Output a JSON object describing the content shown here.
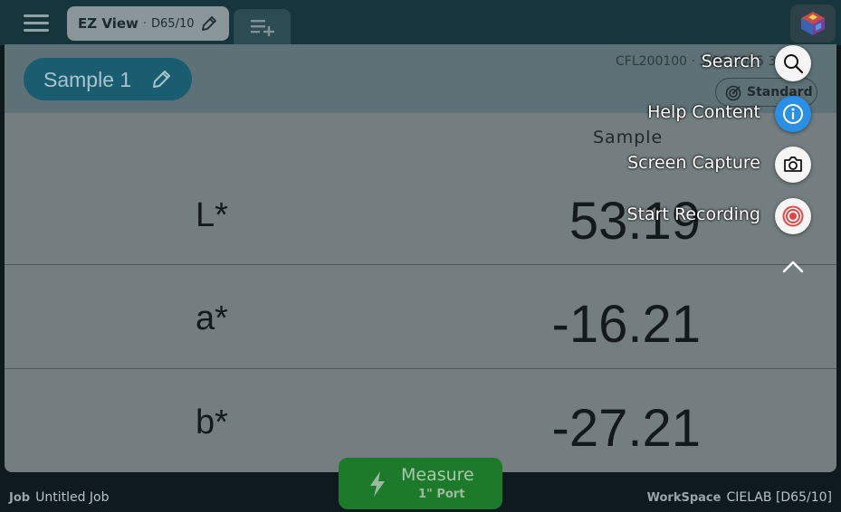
{
  "topbar": {
    "menu_icon": "hamburger-icon",
    "view_tab": {
      "title": "EZ View",
      "separator": "·",
      "illuminant": "D65/10",
      "edit_icon": "pencil-icon"
    },
    "add_tab_icon": "playlist-add-icon",
    "logo_icon": "color-cube-logo"
  },
  "sample": {
    "name": "Sample 1",
    "edit_icon": "pencil-icon"
  },
  "instrument": {
    "text": "CFL200100 · 3/06/2025 3:26"
  },
  "standard": {
    "label": "Standard",
    "icon": "target-icon"
  },
  "table": {
    "column_header": "Sample",
    "rows": [
      {
        "label": "L*",
        "value": "53.19"
      },
      {
        "label": "a*",
        "value": "-16.21"
      },
      {
        "label": "b*",
        "value": "-27.21"
      }
    ]
  },
  "quick_menu": {
    "items": [
      {
        "label": "Search",
        "icon": "search-icon"
      },
      {
        "label": "Help Content",
        "icon": "info-icon"
      },
      {
        "label": "Screen Capture",
        "icon": "camera-icon"
      },
      {
        "label": "Start Recording",
        "icon": "record-icon"
      }
    ],
    "collapse_icon": "chevron-up-icon"
  },
  "measure": {
    "label": "Measure",
    "port": "1\" Port",
    "icon": "lightning-icon"
  },
  "footer": {
    "job_label": "Job",
    "job_value": "Untitled Job",
    "workspace_label": "WorkSpace",
    "workspace_value": "CIELAB [D65/10]"
  },
  "colors": {
    "topbar": "#17353d",
    "panel": "#747e80",
    "header": "#5d7176",
    "sample_pill": "#1b5d70",
    "measure": "#1c7a2a",
    "info_blue": "#2a8fe6",
    "record_red": "#e04848"
  }
}
